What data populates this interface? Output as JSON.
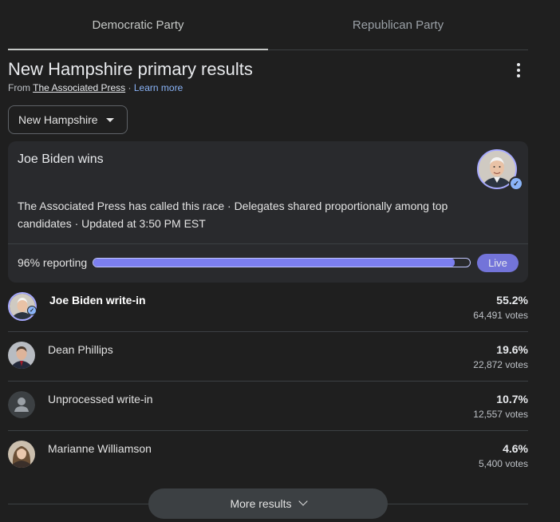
{
  "tabs": [
    {
      "label": "Democratic Party",
      "active": true
    },
    {
      "label": "Republican Party",
      "active": false
    }
  ],
  "header": {
    "title": "New Hampshire primary results",
    "source_prefix": "From",
    "source_name": "The Associated Press",
    "separator": "·",
    "learn_more": "Learn more",
    "menu_icon": "more-vert-icon"
  },
  "state_selector": {
    "value": "New Hampshire",
    "icon": "arrow-drop-down-icon"
  },
  "summary": {
    "headline": "Joe Biden wins",
    "description": "The Associated Press has called this race · Delegates shared proportionally among top candidates · Updated at 3:50 PM EST",
    "reporting_label": "96% reporting",
    "reporting_fraction": 0.96,
    "live_label": "Live",
    "accent_color": "#7c7ff0"
  },
  "candidates": [
    {
      "name": "Joe Biden write-in",
      "percent": "55.2%",
      "votes": "64,491 votes",
      "winner": true,
      "avatar": "biden-avatar"
    },
    {
      "name": "Dean Phillips",
      "percent": "19.6%",
      "votes": "22,872 votes",
      "winner": false,
      "avatar": "phillips-avatar"
    },
    {
      "name": "Unprocessed write-in",
      "percent": "10.7%",
      "votes": "12,557 votes",
      "winner": false,
      "avatar": "person-placeholder-icon"
    },
    {
      "name": "Marianne Williamson",
      "percent": "4.6%",
      "votes": "5,400 votes",
      "winner": false,
      "avatar": "williamson-avatar"
    }
  ],
  "more_results": {
    "label": "More results",
    "icon": "expand-more-icon"
  }
}
